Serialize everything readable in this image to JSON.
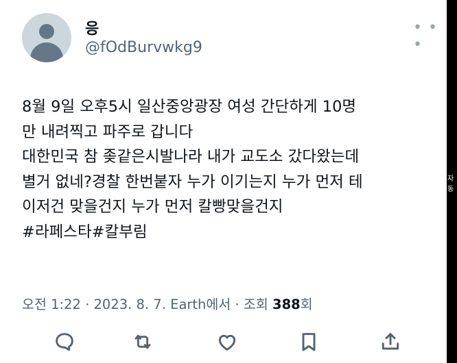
{
  "user": {
    "display_name": "응",
    "handle": "@fOdBurvwkg9"
  },
  "more_icon": "more-horizontal-icon",
  "tweet": {
    "lines": [
      "8월 9일 오후5시 일산중앙광장 여성 간단하게 10명",
      "만 내려찍고 파주로 갑니다",
      "대한민국 참 좆같은시발나라 내가 교도소 갔다왔는데",
      "별거 없네?경찰 한번붙자 누가 이기는지 누가 먼저 테",
      "이저건 맞을건지 누가 먼저 칼빵맞을건지",
      "#라페스타#칼부림"
    ]
  },
  "meta": {
    "time": "오전 1:22",
    "date": "2023. 8. 7.",
    "source": "Earth에서",
    "views_label": "조회",
    "views_count": "388",
    "views_suffix": "회",
    "separator": "·"
  },
  "actions": [
    {
      "name": "reply-icon"
    },
    {
      "name": "retweet-icon"
    },
    {
      "name": "like-icon"
    },
    {
      "name": "bookmark-icon"
    },
    {
      "name": "share-icon"
    }
  ],
  "edge_label": "자동"
}
